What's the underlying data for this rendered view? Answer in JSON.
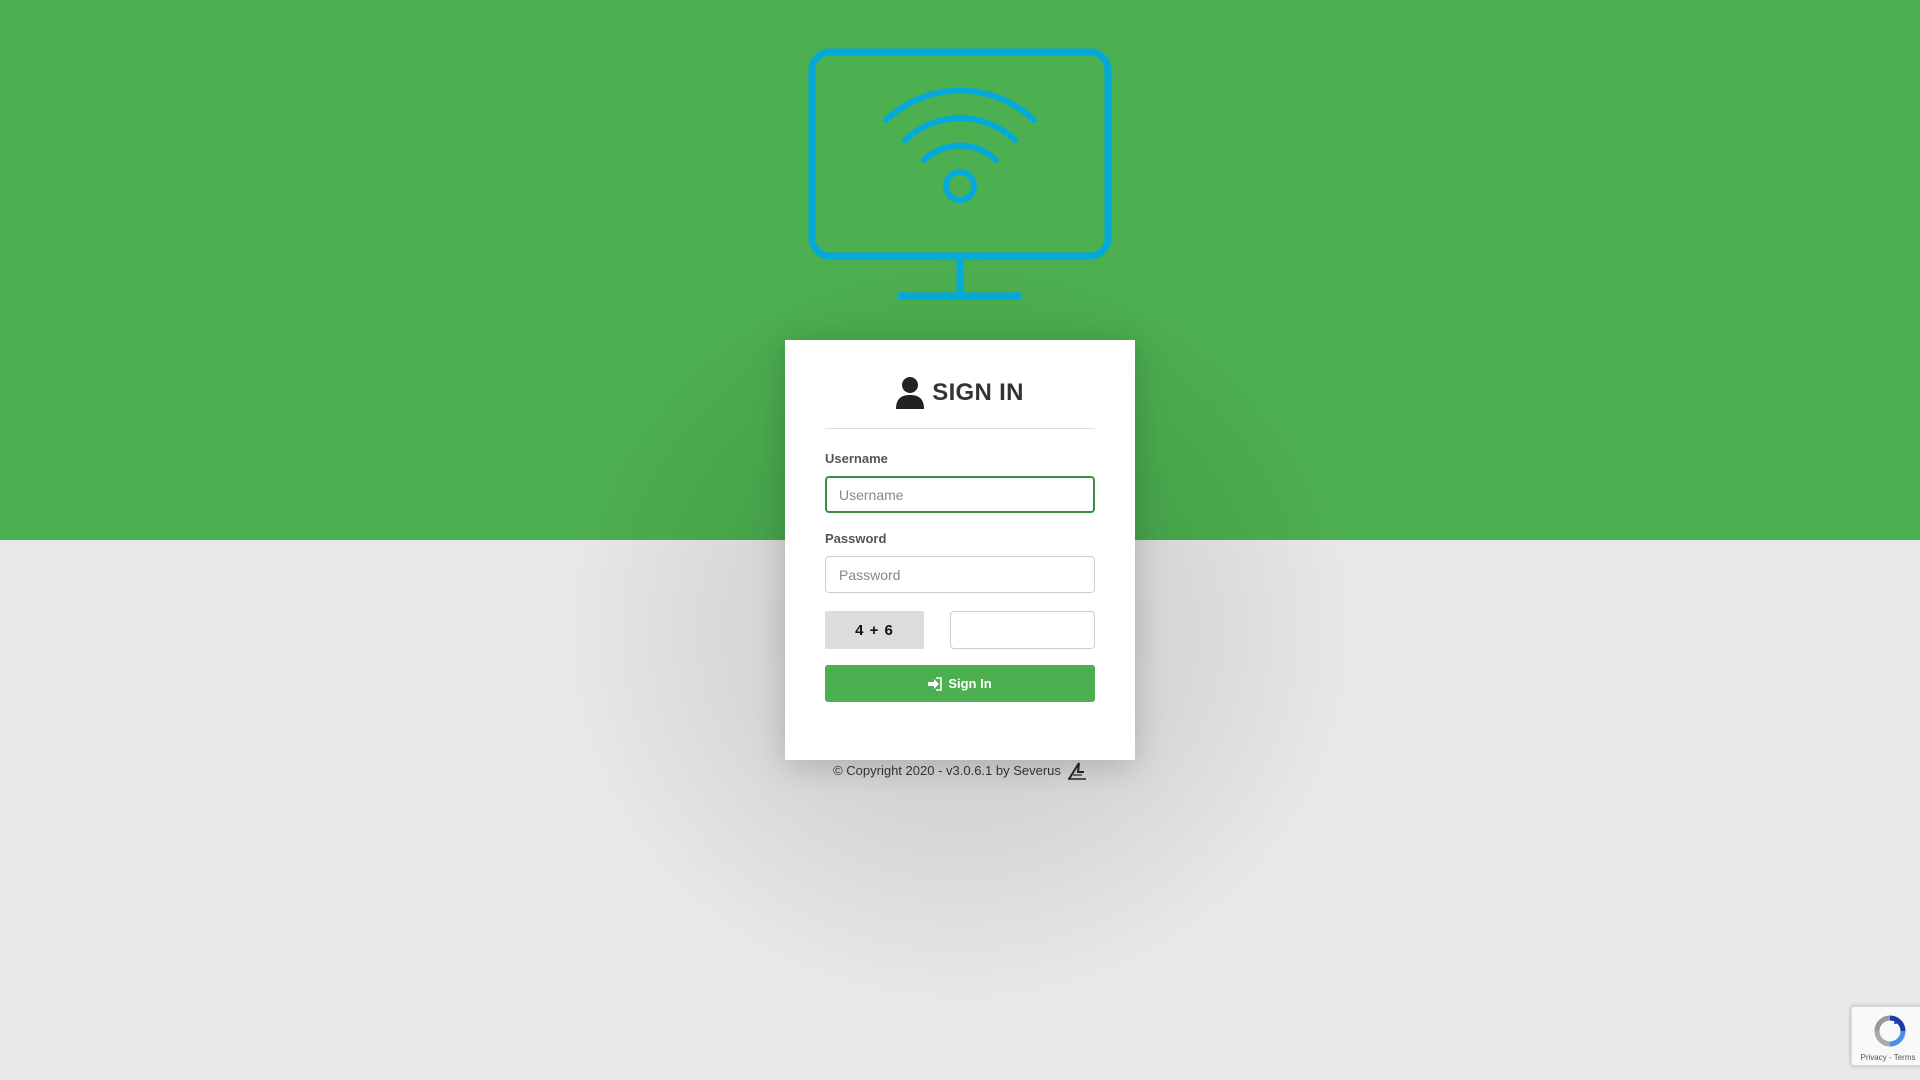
{
  "signin": {
    "title": "SIGN IN",
    "username_label": "Username",
    "username_placeholder": "Username",
    "password_label": "Password",
    "password_placeholder": "Password",
    "captcha_text": "4 + 6",
    "captcha_value": "",
    "button_label": "Sign In"
  },
  "footer": {
    "text": "© Copyright 2020 - v3.0.6.1 by Severus"
  },
  "recaptcha": {
    "links": "Privacy - Terms"
  },
  "colors": {
    "brand_green": "#4caf50",
    "logo_blue": "#03a9d9",
    "background": "#e8e8e8"
  },
  "icons": {
    "logo": "monitor-wifi-icon",
    "title": "user-icon",
    "button": "sign-in-icon",
    "footer": "severus-logo-icon"
  }
}
